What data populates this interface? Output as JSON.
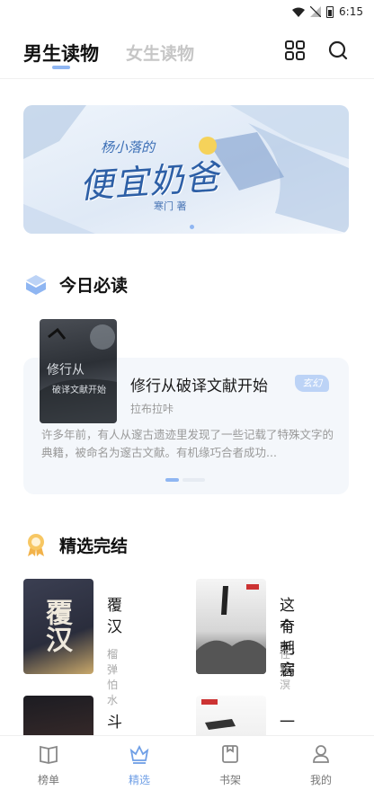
{
  "status_bar": {
    "time": "6:15"
  },
  "header": {
    "tabs": [
      {
        "label": "男生读物",
        "active": true
      },
      {
        "label": "女生读物",
        "active": false
      }
    ],
    "icons": [
      "grid-icon",
      "search-icon"
    ]
  },
  "banner": {
    "title": "便宜奶爸",
    "subtitle": "杨小落的",
    "author_line": "寒门 著",
    "page_count": 1
  },
  "today_section": {
    "title": "今日必读",
    "book": {
      "title": "修行从破译文献开始",
      "tag": "玄幻",
      "author": "拉布拉咔",
      "description": "许多年前，有人从邃古遗迹里发现了一些记载了特殊文字的典籍，被命名为邃古文献。有机缘巧合者成功...",
      "cover_text_1": "修行从",
      "cover_text_2": "破译文献开始"
    }
  },
  "completed_section": {
    "title": "精选完结",
    "books": [
      {
        "title": "覆汉",
        "author": "榴弹怕水",
        "cover_text": "覆汉"
      },
      {
        "title": "这个刺客有毛病",
        "title_line1": "这个刺客",
        "title_line2": "有毛病",
        "author": "任秋溟"
      },
      {
        "title": "斗罗大陆",
        "author": ""
      },
      {
        "title": "一品修仙",
        "author": ""
      }
    ]
  },
  "bottom_nav": [
    {
      "label": "榜单",
      "icon": "book-open-icon",
      "active": false
    },
    {
      "label": "精选",
      "icon": "crown-icon",
      "active": true
    },
    {
      "label": "书架",
      "icon": "bookshelf-icon",
      "active": false
    },
    {
      "label": "我的",
      "icon": "user-icon",
      "active": false
    }
  ],
  "colors": {
    "accent": "#8fb6f2",
    "active_nav": "#6f9fe6",
    "tag_bg": "#bcd3f6",
    "card_bg": "#f4f7fb"
  }
}
